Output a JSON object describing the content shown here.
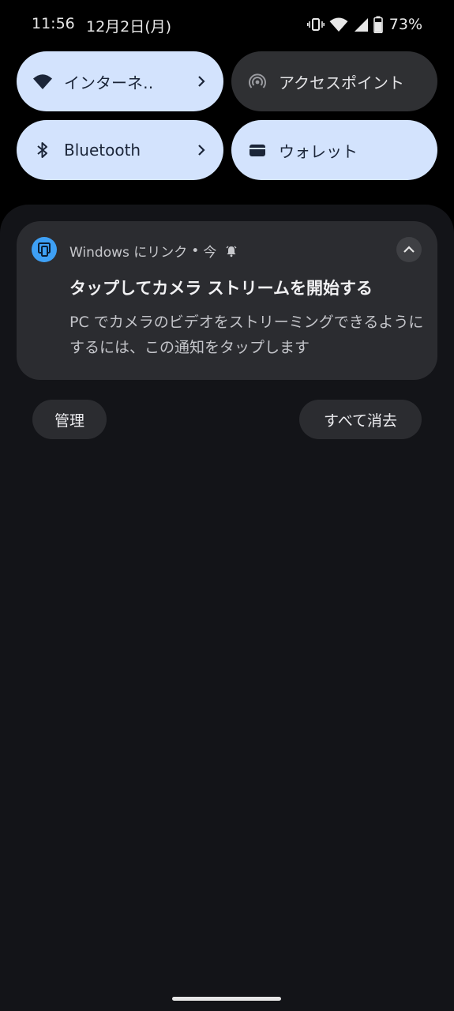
{
  "status_bar": {
    "time": "11:56",
    "date": "12月2日(月)",
    "battery_percent": "73%",
    "battery_level": 0.73,
    "icons": [
      "vibrate-icon",
      "wifi-icon",
      "cell-signal-icon",
      "battery-icon"
    ]
  },
  "quick_settings": {
    "internet": {
      "label": "インターネ‥",
      "icon": "wifi-icon",
      "state": "on",
      "has_chevron": true
    },
    "hotspot": {
      "label": "アクセスポイント",
      "icon": "hotspot-icon",
      "state": "off",
      "has_chevron": false
    },
    "bluetooth": {
      "label": "Bluetooth",
      "icon": "bluetooth-icon",
      "state": "on",
      "has_chevron": true
    },
    "wallet": {
      "label": "ウォレット",
      "icon": "wallet-icon",
      "state": "on",
      "has_chevron": false
    }
  },
  "notification": {
    "app_name": "Windows にリンク",
    "separator": "•",
    "time": "今",
    "app_icon": "phone-link-icon",
    "alert_icon": "bell-icon",
    "title": "タップしてカメラ ストリームを開始する",
    "body": "PC でカメラのビデオをストリーミングできるようにするには、この通知をタップします"
  },
  "actions": {
    "manage_label": "管理",
    "clear_all_label": "すべて消去"
  },
  "colors": {
    "tile_on": "#d3e3fd",
    "tile_off": "#2f3033",
    "shade_bg": "#131418",
    "card_bg": "#2b2c30",
    "app_icon_bg": "#3ea0f5"
  }
}
